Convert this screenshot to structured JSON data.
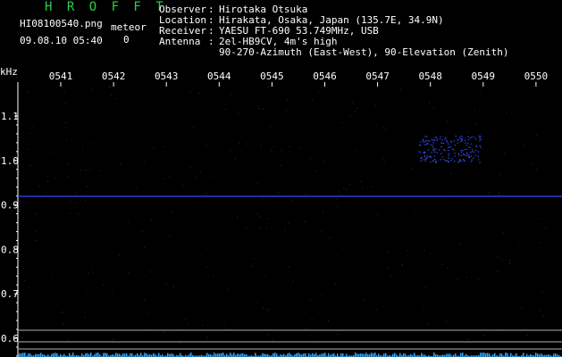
{
  "header": {
    "title": "H R O F F T",
    "file_name": "HI08100540.png",
    "meteor_label": "meteor",
    "meteor_count": "0",
    "datetime": "09.08.10 05:40"
  },
  "station_info": [
    {
      "key": "Observer",
      "value": "Hirotaka Otsuka"
    },
    {
      "key": "Location",
      "value": "Hirakata, Osaka, Japan (135.7E, 34.9N)"
    },
    {
      "key": "Receiver",
      "value": "YAESU FT-690 53.749MHz, USB"
    },
    {
      "key": "Antenna",
      "value": "2el-HB9CV, 4m's high"
    },
    {
      "key": "",
      "value": "90-270-Azimuth (East-West), 90-Elevation (Zenith)"
    }
  ],
  "axes": {
    "y_unit": "kHz",
    "x_ticks": [
      "0541",
      "0542",
      "0543",
      "0544",
      "0545",
      "0546",
      "0547",
      "0548",
      "0549",
      "0550"
    ],
    "y_ticks": [
      "1.1",
      "1.0",
      "0.9",
      "0.8",
      "0.7",
      "0.6"
    ]
  },
  "colors": {
    "title": "#2ad14a",
    "carrier_line": "#2b3bd6",
    "echo": "#3550ff",
    "noise": "#35a6ff",
    "guide_lines": "#b0b0b0"
  }
}
